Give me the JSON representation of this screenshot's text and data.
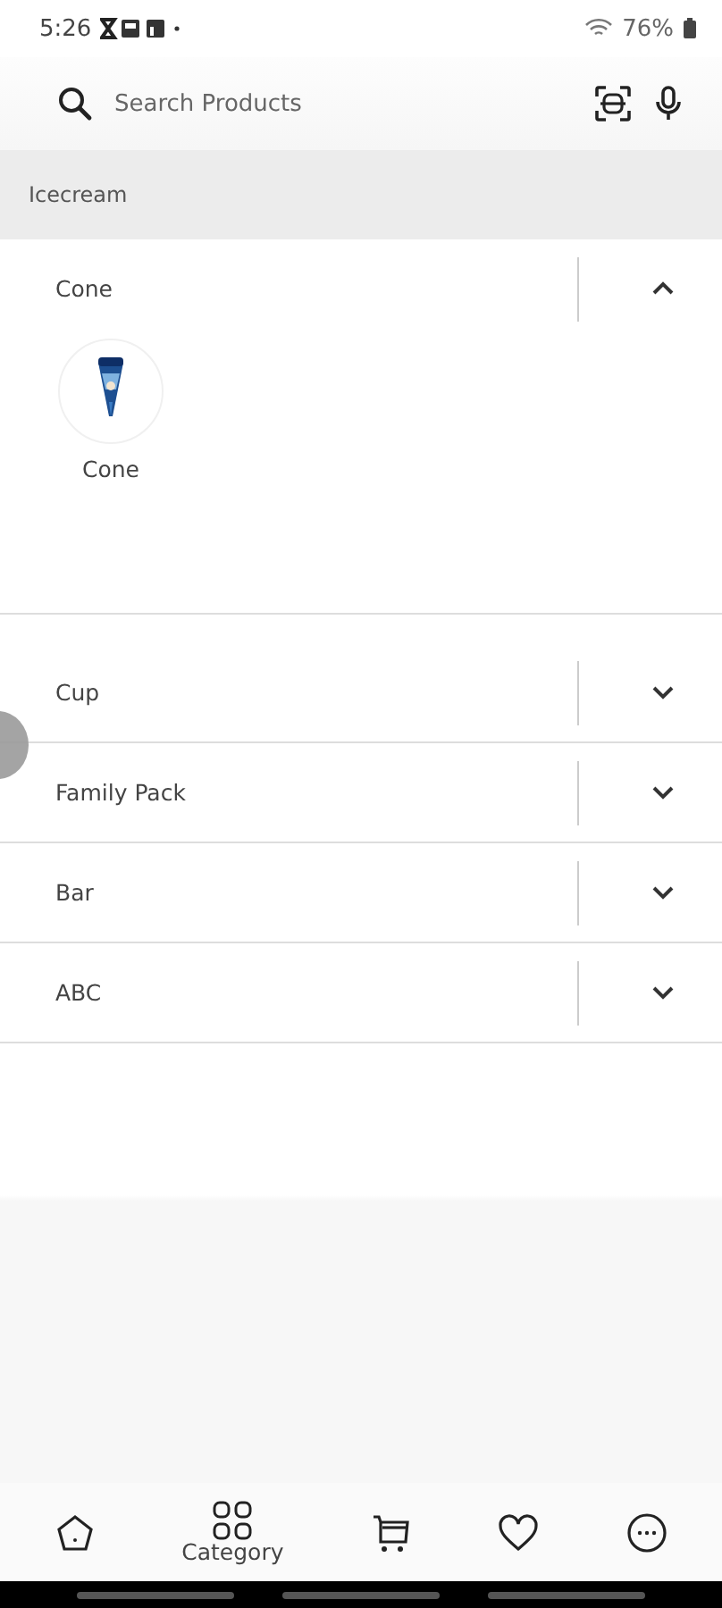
{
  "status_bar": {
    "time": "5:26",
    "battery": "76%"
  },
  "search": {
    "placeholder": "Search Products"
  },
  "category": {
    "title": "Icecream"
  },
  "sections": [
    {
      "title": "Cone",
      "expanded": true,
      "items": [
        {
          "label": "Cone",
          "kind": "picture"
        }
      ]
    },
    {
      "title": "Cup",
      "expanded": false
    },
    {
      "title": "Family Pack",
      "expanded": false
    },
    {
      "title": "Bar",
      "expanded": false
    },
    {
      "title": "ABC",
      "expanded": false
    }
  ],
  "nav": [
    {
      "kind": "home"
    },
    {
      "kind": "category",
      "label": "Category"
    },
    {
      "kind": "cart"
    },
    {
      "kind": "heart"
    },
    {
      "kind": "more"
    }
  ]
}
